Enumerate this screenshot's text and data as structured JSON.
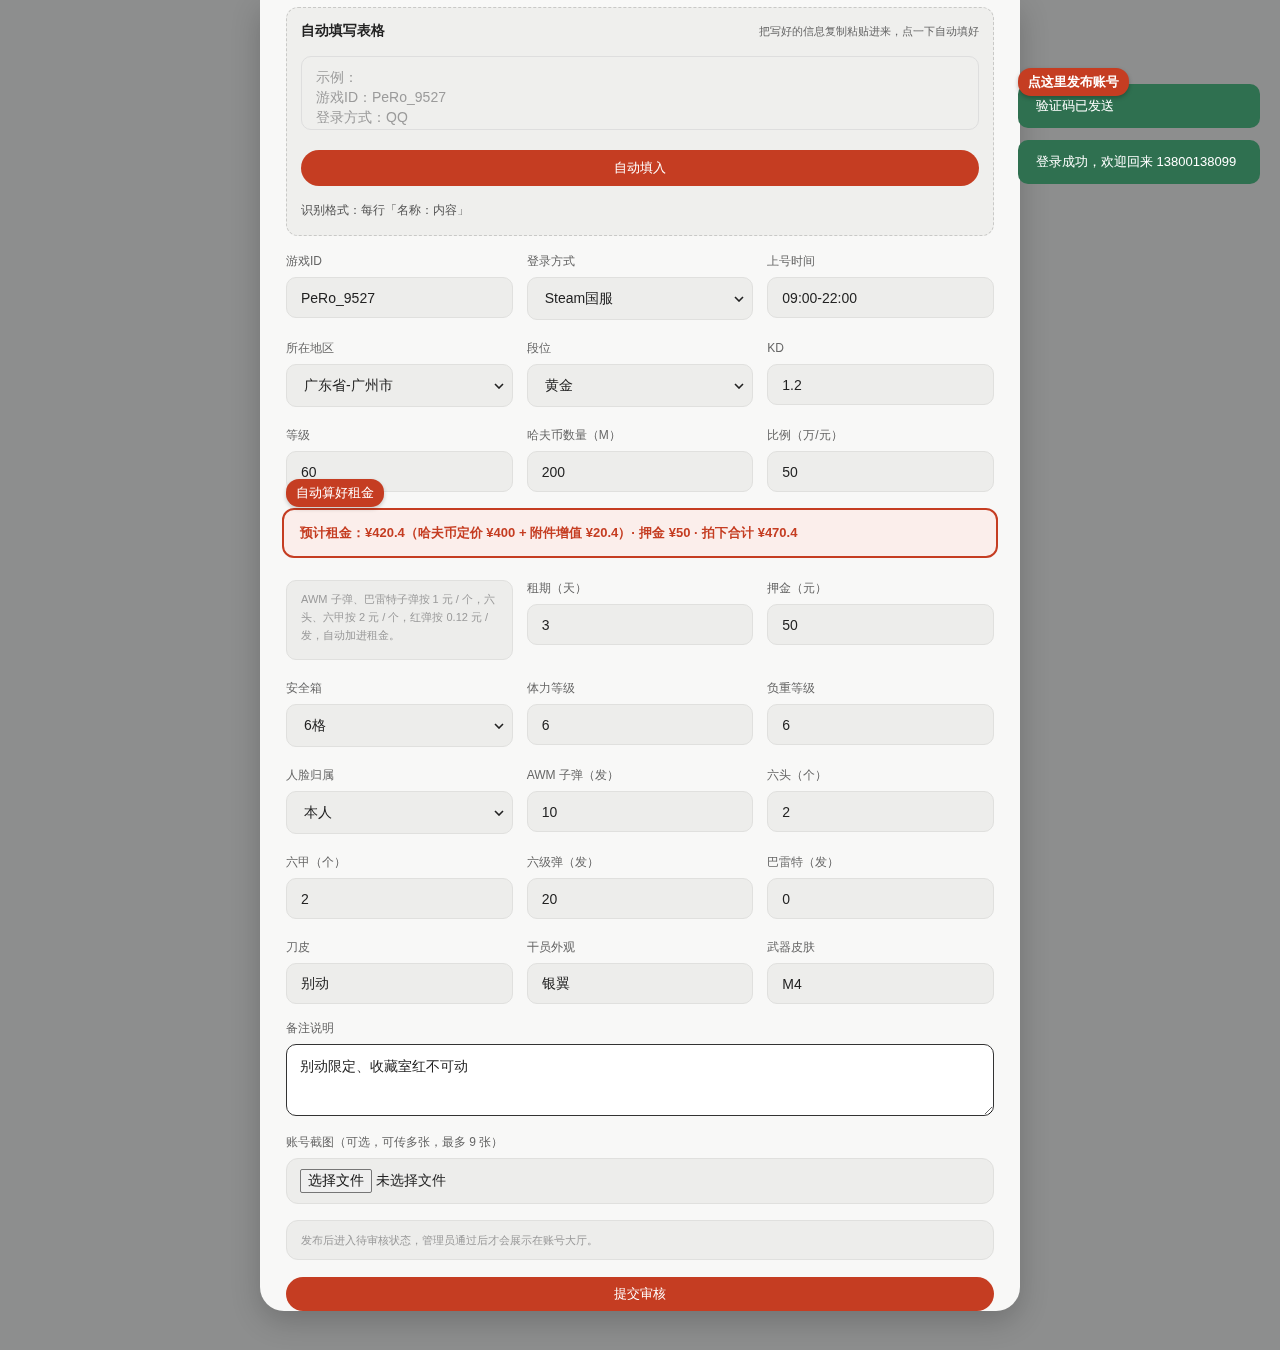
{
  "autofill": {
    "title": "自动填写表格",
    "hint": "把写好的信息复制粘贴进来，点一下自动填好",
    "placeholder_lines": [
      "示例：",
      "游戏ID：PeRo_9527",
      "登录方式：QQ"
    ],
    "button": "自动填入",
    "format_note": "识别格式：每行「名称：内容」"
  },
  "fields_top": [
    {
      "kind": "input",
      "label": "游戏ID",
      "value": "PeRo_9527"
    },
    {
      "kind": "select",
      "label": "登录方式",
      "value": "Steam国服"
    },
    {
      "kind": "input",
      "label": "上号时间",
      "value": "09:00-22:00"
    },
    {
      "kind": "select",
      "label": "所在地区",
      "value": "广东省-广州市"
    },
    {
      "kind": "select",
      "label": "段位",
      "value": "黄金"
    },
    {
      "kind": "input",
      "label": "KD",
      "value": "1.2"
    },
    {
      "kind": "input",
      "label": "等级",
      "value": "60"
    },
    {
      "kind": "input",
      "label": "哈夫币数量（M）",
      "value": "200"
    },
    {
      "kind": "input",
      "label": "比例（万/元）",
      "value": "50"
    }
  ],
  "rent_badge": "自动算好租金",
  "rent_summary": "预计租金：¥420.4（哈夫币定价 ¥400 + 附件增值 ¥20.4）· 押金 ¥50 · 拍下合计 ¥470.4",
  "fields_bottom": [
    {
      "kind": "note",
      "text": "AWM 子弹、巴雷特子弹按 1 元 / 个，六头、六甲按 2 元 / 个，红弹按 0.12 元 / 发，自动加进租金。"
    },
    {
      "kind": "input",
      "label": "租期（天）",
      "value": "3"
    },
    {
      "kind": "input",
      "label": "押金（元）",
      "value": "50"
    },
    {
      "kind": "select",
      "label": "安全箱",
      "value": "6格"
    },
    {
      "kind": "input",
      "label": "体力等级",
      "value": "6"
    },
    {
      "kind": "input",
      "label": "负重等级",
      "value": "6"
    },
    {
      "kind": "select",
      "label": "人脸归属",
      "value": "本人"
    },
    {
      "kind": "input",
      "label": "AWM 子弹（发）",
      "value": "10"
    },
    {
      "kind": "input",
      "label": "六头（个）",
      "value": "2"
    },
    {
      "kind": "input",
      "label": "六甲（个）",
      "value": "2"
    },
    {
      "kind": "input",
      "label": "六级弹（发）",
      "value": "20"
    },
    {
      "kind": "input",
      "label": "巴雷特（发）",
      "value": "0"
    },
    {
      "kind": "input",
      "label": "刀皮",
      "value": "别动"
    },
    {
      "kind": "input",
      "label": "干员外观",
      "value": "银翼"
    },
    {
      "kind": "input",
      "label": "武器皮肤",
      "value": "M4"
    }
  ],
  "remarks": {
    "label": "备注说明",
    "value": "别动限定、收藏室红不可动"
  },
  "screenshots": {
    "label": "账号截图（可选，可传多张，最多 9 张）",
    "button": "选择文件",
    "status": "未选择文件"
  },
  "notice": "发布后进入待审核状态，管理员通过后才会展示在账号大厅。",
  "submit": "提交审核",
  "publish_badge": "点这里发布账号",
  "toasts": [
    "验证码已发送",
    "登录成功，欢迎回来 13800138099"
  ]
}
